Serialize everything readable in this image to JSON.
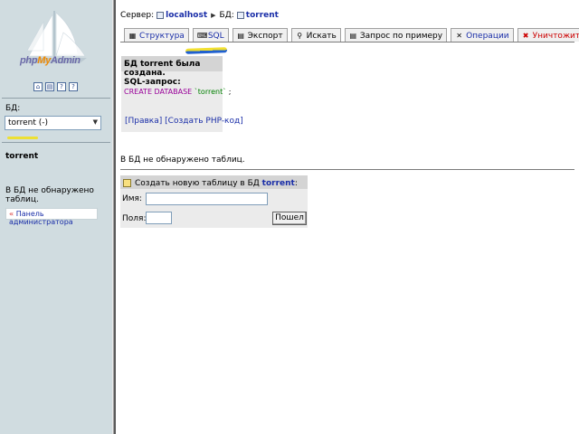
{
  "sidebar": {
    "logo": {
      "php": "php",
      "my": "My",
      "admin": "Admin"
    },
    "db_label": "БД:",
    "db_select_value": "torrent (-)",
    "current_db": "torrent",
    "no_tables": "В БД не обнаружено таблиц.",
    "admin_panel_link": "Панель администратора"
  },
  "breadcrumb": {
    "server_label": "Сервер:",
    "server": "localhost",
    "db_label": "БД:",
    "db": "torrent"
  },
  "tabs": [
    {
      "label": "Структура",
      "icon": "structure-icon",
      "glyph": "▦"
    },
    {
      "label": "SQL",
      "icon": "sql-icon",
      "glyph": "⌨"
    },
    {
      "label": "Экспорт",
      "icon": "export-icon",
      "glyph": "▤"
    },
    {
      "label": "Искать",
      "icon": "search-icon",
      "glyph": "⚲"
    },
    {
      "label": "Запрос по примеру",
      "icon": "query-icon",
      "glyph": "▤"
    },
    {
      "label": "Операции",
      "icon": "tools-icon",
      "glyph": "✕"
    },
    {
      "label": "Уничтожить",
      "icon": "drop-icon",
      "glyph": "✖"
    }
  ],
  "message": {
    "title": "БД torrent была создана.",
    "sql_label": "SQL-запрос:",
    "sql_keyword": "CREATE DATABASE",
    "sql_value": "`torrent`",
    "sql_end": " ;",
    "link_edit": "[Правка]",
    "link_php": "[Создать PHP-код]"
  },
  "main": {
    "no_tables": "В БД не обнаружено таблиц."
  },
  "create_table": {
    "title_prefix": "Создать новую таблицу в БД",
    "db": "torrent",
    "title_suffix": ":",
    "name_label": "Имя:",
    "name_value": "",
    "fields_label": "Поля:",
    "fields_value": "",
    "go_label": "Пошел"
  },
  "colors": {
    "sidebar_bg": "#d0dce0",
    "link": "#1a2ea8",
    "danger": "#cc0000",
    "highlight_yellow": "#f0e020"
  }
}
